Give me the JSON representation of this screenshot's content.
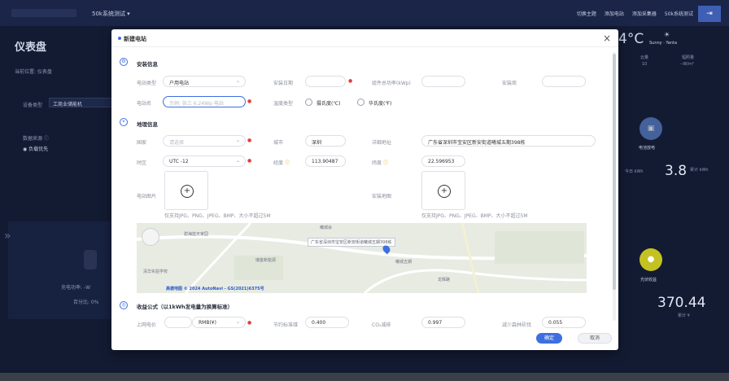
{
  "topbar": {
    "system_name": "50k系统测试 ▾",
    "actions": [
      "切换主题",
      "添加电站",
      "添加采集器",
      "50k系统测试"
    ],
    "exit_icon": "logout-icon"
  },
  "dashboard": {
    "title": "仪表盘",
    "breadcrumb": "当前位置: 仪表盘",
    "device_type_label": "设备类型",
    "device_type_value": "工商业储能机",
    "data_source_label": "数据来源 ⓘ",
    "data_source_option": "负载优先",
    "charge_power_label": "充电功率: -W",
    "percent_label": "百分比: 0%",
    "weather_temp": "4°C",
    "weather_cond": "Sunny · Yanta",
    "stat_labels": [
      "云量",
      "辐照量"
    ],
    "stat_values": [
      "10",
      "--W/m²"
    ],
    "discharge_label": "电池放电",
    "today_unit": "今日 kWh",
    "discharge_value": "3.8",
    "discharge_unit": "累计 kWh",
    "pv_label": "光伏收益",
    "pv_value": "370.44",
    "pv_unit": "累计 ¥"
  },
  "modal": {
    "title": "新建电站",
    "install_section": "安装信息",
    "geo_section": "地理信息",
    "revenue_section": "收益公式（以1kWh发电量为换算标准）",
    "fields": {
      "station_type_label": "电站类型",
      "station_type_value": "户用电站",
      "install_date_label": "安装日期",
      "capacity_label": "组件总功率(kWp)",
      "installer_label": "安装商",
      "station_name_label": "电站名",
      "station_name_placeholder": "示例: 张三 6.24Wp 电站",
      "temp_type_label": "温度类型",
      "celsius": "摄氏度(℃)",
      "fahrenheit": "华氏度(℉)",
      "country_label": "国家",
      "country_placeholder": "请选择",
      "city_label": "城市",
      "city_value": "深圳",
      "address_label": "详细地址",
      "address_value": "广东省深圳市宝安区新安街道曦城五期398栋",
      "timezone_label": "时区",
      "timezone_value": "UTC -12",
      "longitude_label": "经度",
      "longitude_value": "113.90487",
      "latitude_label": "纬度",
      "latitude_value": "22.596953",
      "station_image_label": "电站图片",
      "install_map_label": "安装地图",
      "upload_hint": "仅支持JPG、PNG、JPEG、BMP、大小不超过5M",
      "grid_price_label": "上网电价",
      "currency_value": "RMB(¥)",
      "coal_label": "节约标准煤",
      "coal_value": "0.400",
      "co2_label": "CO₂减排",
      "co2_value": "0.997",
      "forest_label": "减少森林砍伐",
      "forest_value": "0.055"
    },
    "map": {
      "address_tip": "广东省深圳市宝安区新安街道曦城五期398栋",
      "place_labels": [
        "曦城会",
        "碧海蓝天家园",
        "瑞金新能源",
        "曦城五期",
        "龙辉路",
        "清华实验学校"
      ],
      "provider": "高德地图 © 2024 AutoNavi - GS(2021)6375号"
    },
    "buttons": {
      "ok": "确定",
      "cancel": "取消"
    },
    "colors": {
      "accent": "#3d6fe0",
      "required": "#e04040"
    }
  }
}
